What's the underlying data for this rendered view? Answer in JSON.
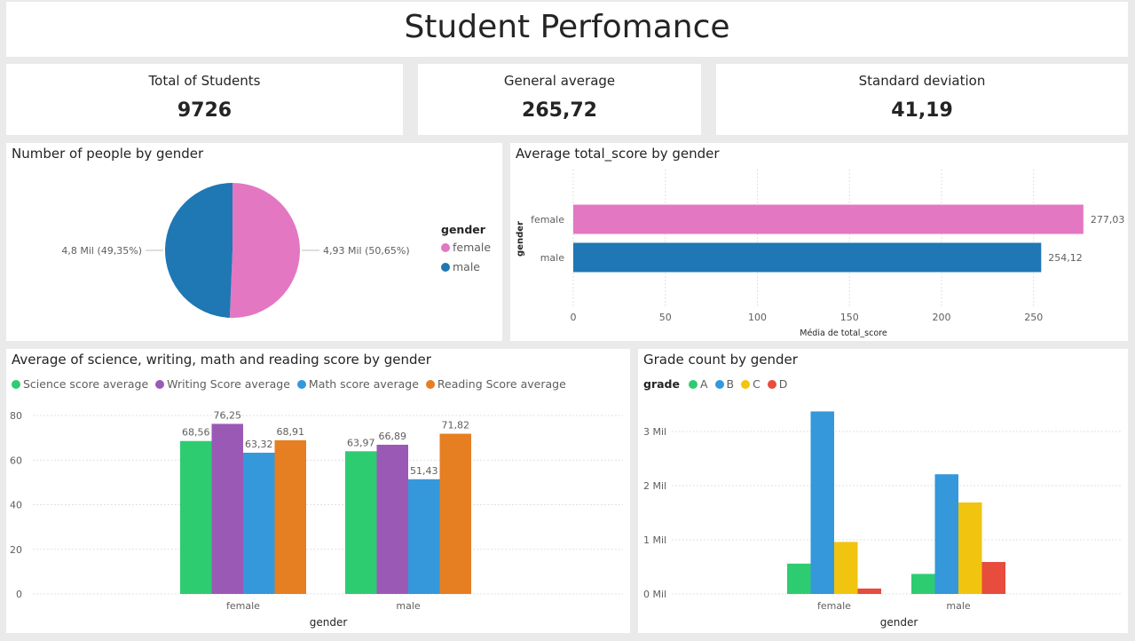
{
  "header": {
    "title": "Student Perfomance"
  },
  "kpis": [
    {
      "label": "Total of Students",
      "value": "9726"
    },
    {
      "label": "General average",
      "value": "265,72"
    },
    {
      "label": "Standard deviation",
      "value": "41,19"
    }
  ],
  "colors": {
    "female": "#e377c2",
    "male": "#1f77b4",
    "science": "#2ecc71",
    "writing": "#9b59b6",
    "math": "#3498db",
    "reading": "#e67e22",
    "grade_A": "#2ecc71",
    "grade_B": "#3498db",
    "grade_C": "#f1c40f",
    "grade_D": "#e74c3c"
  },
  "chart_data": [
    {
      "type": "pie",
      "title": "Number of people by gender",
      "legend_title": "gender",
      "legend_position": "right",
      "slices": [
        {
          "name": "female",
          "value": 4926,
          "pct": 50.65,
          "label": "4,93 Mil (50,65%)"
        },
        {
          "name": "male",
          "value": 4800,
          "pct": 49.35,
          "label": "4,8 Mil (49,35%)"
        }
      ]
    },
    {
      "type": "bar",
      "orientation": "horizontal",
      "title": "Average total_score by gender",
      "xlabel": "Média de total_score",
      "ylabel": "gender",
      "categories": [
        "female",
        "male"
      ],
      "values": [
        277.03,
        254.12
      ],
      "value_labels": [
        "277,03",
        "254,12"
      ],
      "xlim": [
        0,
        280
      ],
      "xticks": [
        0,
        50,
        100,
        150,
        200,
        250
      ],
      "grid": true
    },
    {
      "type": "bar",
      "title": "Average of science, writing, math and reading score by gender",
      "xlabel": "gender",
      "ylabel": "",
      "categories": [
        "female",
        "male"
      ],
      "ylim": [
        0,
        80
      ],
      "yticks": [
        0,
        20,
        40,
        60,
        80
      ],
      "legend_position": "top",
      "grid": true,
      "series": [
        {
          "name": "Science score average",
          "values": [
            68.56,
            63.97
          ],
          "labels": [
            "68,56",
            "63,97"
          ]
        },
        {
          "name": "Writing Score average",
          "values": [
            76.25,
            66.89
          ],
          "labels": [
            "76,25",
            "66,89"
          ]
        },
        {
          "name": "Math score average",
          "values": [
            63.32,
            51.43
          ],
          "labels": [
            "63,32",
            "51,43"
          ]
        },
        {
          "name": "Reading Score average",
          "values": [
            68.91,
            71.82
          ],
          "labels": [
            "68,91",
            "71,82"
          ]
        }
      ]
    },
    {
      "type": "bar",
      "title": "Grade count by gender",
      "xlabel": "gender",
      "ylabel": "",
      "legend_title": "grade",
      "legend_position": "top",
      "categories": [
        "female",
        "male"
      ],
      "ylim": [
        0,
        3500
      ],
      "yticks": [
        0,
        1000,
        2000,
        3000
      ],
      "ytick_labels": [
        "0 Mil",
        "1 Mil",
        "2 Mil",
        "3 Mil"
      ],
      "grid": true,
      "series": [
        {
          "name": "A",
          "values": [
            560,
            370
          ]
        },
        {
          "name": "B",
          "values": [
            3370,
            2210
          ]
        },
        {
          "name": "C",
          "values": [
            960,
            1690
          ]
        },
        {
          "name": "D",
          "values": [
            100,
            590
          ]
        }
      ]
    }
  ]
}
